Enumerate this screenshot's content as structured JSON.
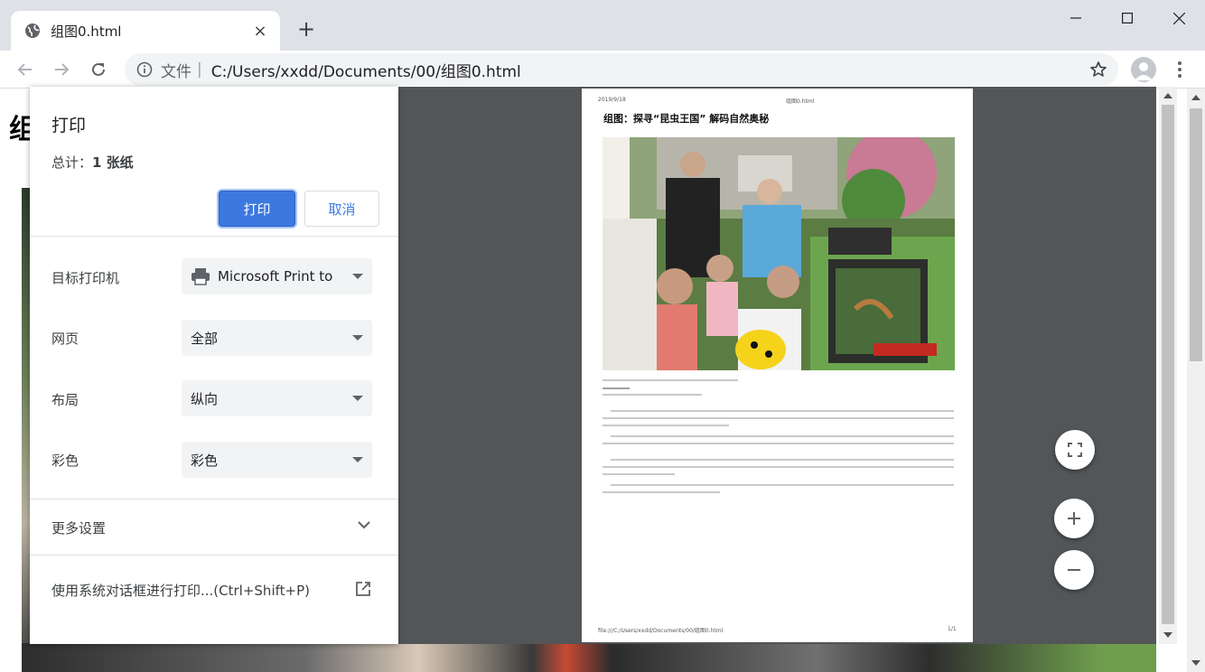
{
  "browser": {
    "tab_title": "组图0.html",
    "new_tab_icon": "+",
    "close_tab_icon": "×",
    "address_scheme": "文件",
    "address_separator": "|",
    "address_url": "C:/Users/xxdd/Documents/00/组图0.html"
  },
  "page": {
    "heading_partial": "组"
  },
  "print_dialog": {
    "title": "打印",
    "total_label": "总计：",
    "total_value": "1 张纸",
    "print_button": "打印",
    "cancel_button": "取消",
    "options": [
      {
        "label": "目标打印机",
        "value": "Microsoft Print to"
      },
      {
        "label": "网页",
        "value": "全部"
      },
      {
        "label": "布局",
        "value": "纵向"
      },
      {
        "label": "彩色",
        "value": "彩色"
      }
    ],
    "more_settings": "更多设置",
    "system_dialog": "使用系统对话框进行打印...(Ctrl+Shift+P)"
  },
  "preview": {
    "header_date": "2019/9/18",
    "header_file": "组图0.html",
    "article_title": "组图：探寻“昆虫王国” 解码自然奥秘",
    "footer_path": "file:///C:/Users/xxdd/Documents/00/组图0.html",
    "footer_page": "1/1"
  },
  "icons": {
    "globe": "globe-icon",
    "back": "arrow-left-icon",
    "forward": "arrow-right-icon",
    "reload": "reload-icon",
    "info": "info-icon",
    "star": "star-icon",
    "printer": "printer-icon",
    "chevron": "chevron-down-icon",
    "external": "open-external-icon",
    "fit": "fit-page-icon",
    "zoom_in": "plus-icon",
    "zoom_out": "minus-icon"
  },
  "colors": {
    "accent": "#3c78e0",
    "preview_bg": "#525659",
    "tabstrip": "#dee1e6"
  }
}
